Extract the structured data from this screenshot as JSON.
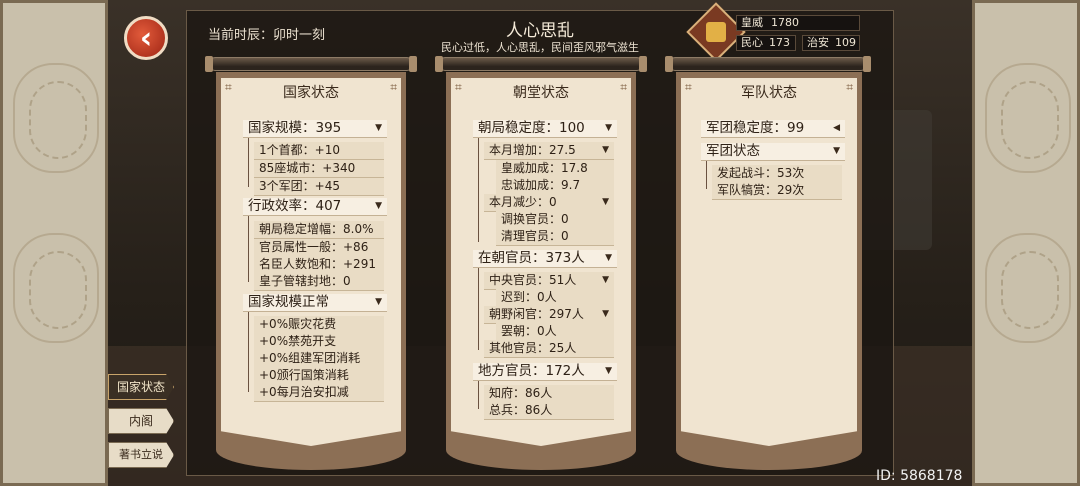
{
  "header": {
    "time_label": "当前时辰：卯时一刻",
    "title": "人心思乱",
    "subtitle": "民心过低，人心思乱，民间歪风邪气滋生"
  },
  "stats": {
    "prestige_label": "皇威",
    "prestige_value": "1780",
    "morale_label": "民心",
    "morale_value": "173",
    "order_label": "治安",
    "order_value": "109"
  },
  "panels": {
    "national": {
      "title": "国家状态",
      "scale": {
        "label": "国家规模：395",
        "items": [
          "1个首都：+10",
          "85座城市：+340",
          "3个军团：+45"
        ]
      },
      "efficiency": {
        "label": "行政效率：407",
        "items": [
          "朝局稳定增幅：8.0%",
          "官员属性一般：+86",
          "名臣人数饱和：+291",
          "皇子管辖封地：0"
        ]
      },
      "normal": {
        "label": "国家规模正常",
        "items": [
          "+0%赈灾花费",
          "+0%禁苑开支",
          "+0%组建军团消耗",
          "+0颁行国策消耗",
          "+0每月治安扣减"
        ]
      }
    },
    "court": {
      "title": "朝堂状态",
      "stability": {
        "label": "朝局稳定度：100"
      },
      "increase": {
        "label": "本月增加：27.5",
        "items": [
          "皇威加成：17.8",
          "忠诚加成：9.7"
        ]
      },
      "decrease": {
        "label": "本月减少：0",
        "items": [
          "调换官员：0",
          "清理官员：0"
        ]
      },
      "officials": {
        "label": "在朝官员：373人"
      },
      "central": {
        "label": "中央官员：51人",
        "items": [
          "迟到：0人"
        ]
      },
      "idle": {
        "label": "朝野闲官：297人",
        "items": [
          "罢朝：0人"
        ]
      },
      "others": {
        "label": "其他官员：25人"
      },
      "local": {
        "label": "地方官员：172人",
        "items": [
          "知府：86人",
          "总兵：86人"
        ]
      }
    },
    "army": {
      "title": "军队状态",
      "stability": {
        "label": "军团稳定度：99"
      },
      "status": {
        "label": "军团状态",
        "items": [
          "发起战斗：53次",
          "军队犒赏：29次"
        ]
      }
    }
  },
  "tabs": [
    "国家状态",
    "内阁",
    "著书立说"
  ],
  "user_id": "ID: 5868178"
}
